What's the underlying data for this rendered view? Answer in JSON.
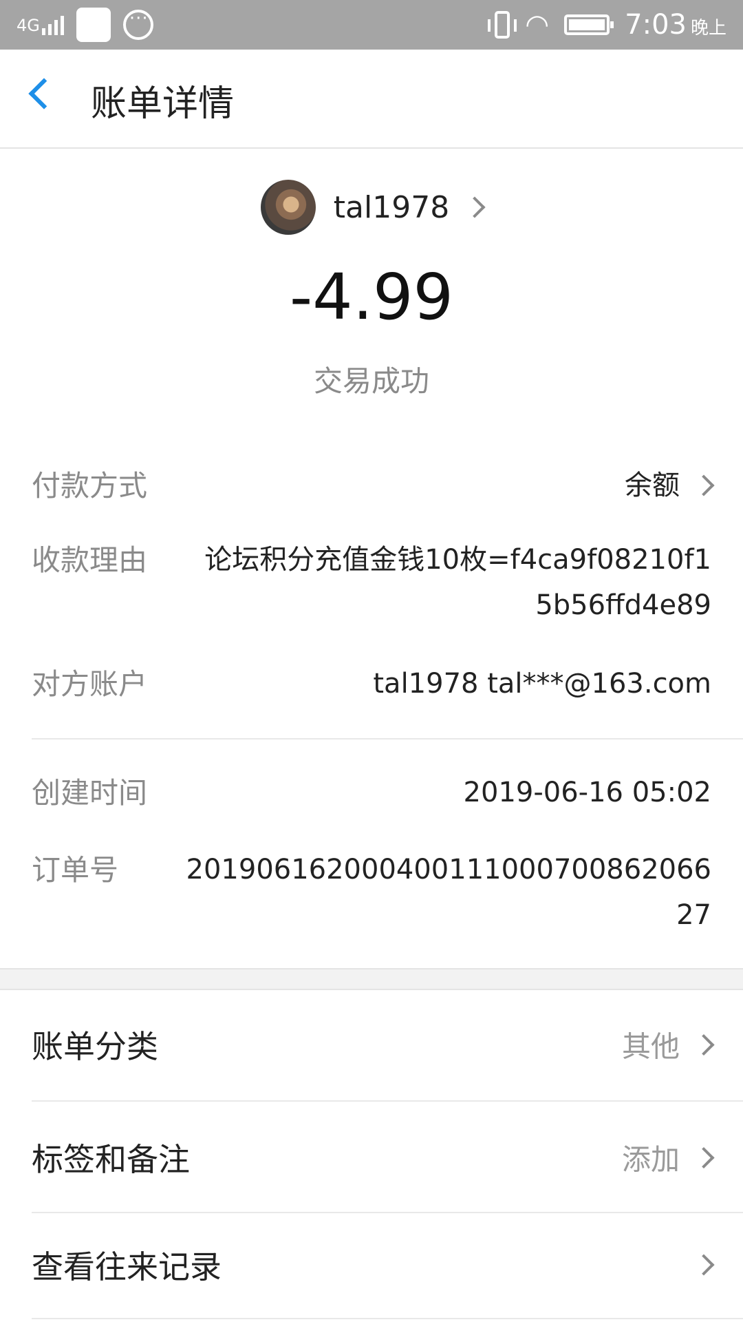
{
  "status_bar": {
    "network": "4G",
    "time": "7:03",
    "period": "晚上"
  },
  "header": {
    "title": "账单详情"
  },
  "transaction": {
    "username": "tal1978",
    "amount": "-4.99",
    "status": "交易成功"
  },
  "details": [
    {
      "label": "付款方式",
      "value": "余额"
    },
    {
      "label": "收款理由",
      "value_line1": "论坛积分充值金钱10枚=f4ca9f08210f1",
      "value_line2": "5b56ffd4e89"
    },
    {
      "label": "对方账户",
      "value": "tal1978 tal***@163.com"
    },
    {
      "label": "创建时间",
      "value": "2019-06-16 05:02"
    },
    {
      "label": "订单号",
      "value_line1": "201906162000400111000700862066",
      "value_line2": "27"
    }
  ],
  "actions": [
    {
      "label": "账单分类",
      "value": "其他"
    },
    {
      "label": "标签和备注",
      "value": "添加"
    },
    {
      "label": "查看往来记录",
      "value": ""
    }
  ],
  "colors": {
    "accent": "#1e8fe8",
    "status_bar": "#a5a5a5",
    "muted_text": "#8a8a8a"
  }
}
